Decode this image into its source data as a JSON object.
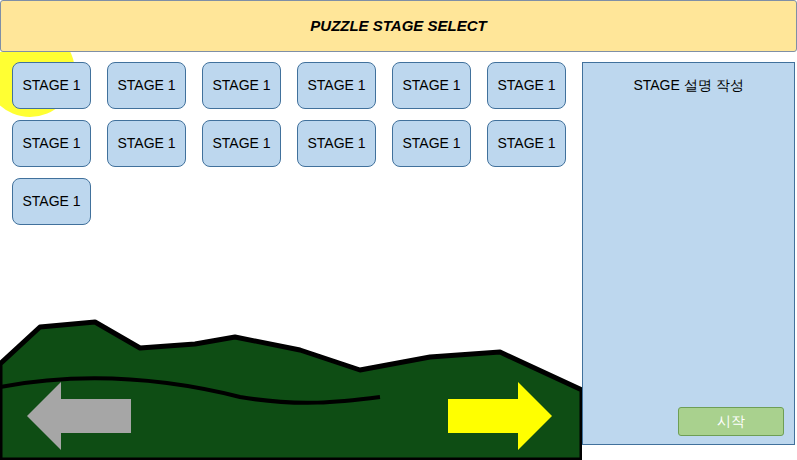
{
  "title": "PUZZLE STAGE SELECT",
  "stages": [
    {
      "label": "STAGE 1"
    },
    {
      "label": "STAGE 1"
    },
    {
      "label": "STAGE 1"
    },
    {
      "label": "STAGE 1"
    },
    {
      "label": "STAGE 1"
    },
    {
      "label": "STAGE 1"
    },
    {
      "label": "STAGE 1"
    },
    {
      "label": "STAGE 1"
    },
    {
      "label": "STAGE 1"
    },
    {
      "label": "STAGE 1"
    },
    {
      "label": "STAGE 1"
    },
    {
      "label": "STAGE 1"
    },
    {
      "label": "STAGE 1"
    }
  ],
  "panel": {
    "description": "STAGE 설명 작성",
    "start_button": "시작"
  }
}
